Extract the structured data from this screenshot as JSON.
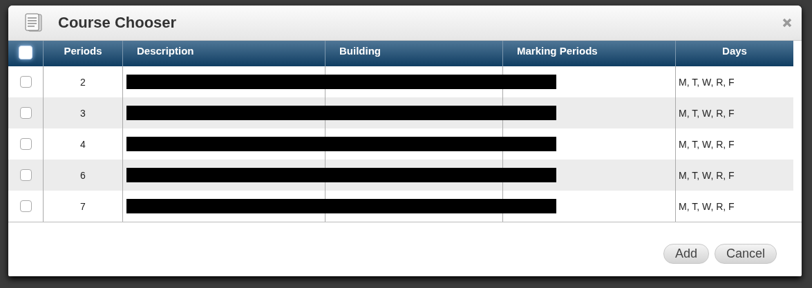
{
  "dialog": {
    "title": "Course Chooser"
  },
  "table": {
    "select_all": {
      "checked": false
    },
    "columns": [
      "Periods",
      "Description",
      "Building",
      "Marking Periods",
      "Days"
    ],
    "rows": [
      {
        "checked": false,
        "period": "2",
        "days": "M, T, W, R, F",
        "redacted": true
      },
      {
        "checked": false,
        "period": "3",
        "days": "M, T, W, R, F",
        "redacted": true
      },
      {
        "checked": false,
        "period": "4",
        "days": "M, T, W, R, F",
        "redacted": true
      },
      {
        "checked": false,
        "period": "6",
        "days": "M, T, W, R, F",
        "redacted": true
      },
      {
        "checked": false,
        "period": "7",
        "days": "M, T, W, R, F",
        "redacted": true
      }
    ]
  },
  "buttons": [
    "Add",
    "Cancel"
  ]
}
